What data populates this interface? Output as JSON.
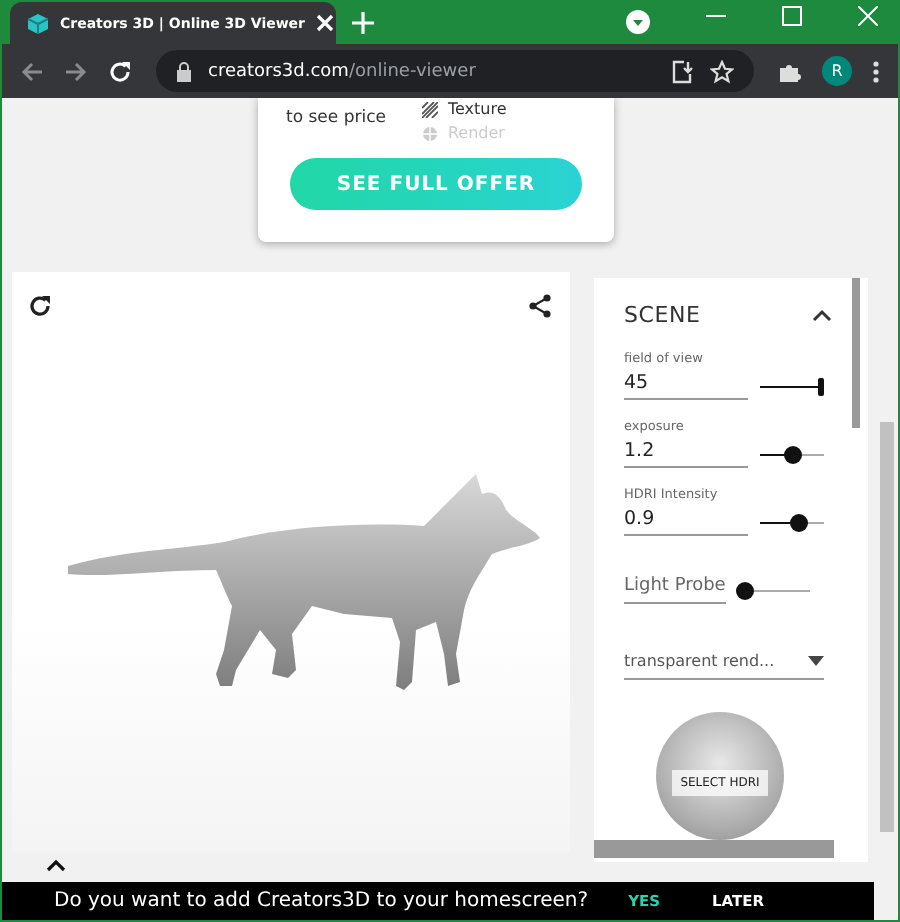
{
  "browser": {
    "tab_title": "Creators 3D | Online 3D Viewer",
    "address": {
      "domain": "creators3d.com",
      "path": "/online-viewer"
    },
    "profile_initial": "R"
  },
  "offer_card": {
    "price_note": "to see price",
    "features": [
      {
        "label": "Texture",
        "disabled": false
      },
      {
        "label": "Render",
        "disabled": true
      }
    ],
    "button": "SEE FULL OFFER"
  },
  "scene_panel": {
    "title": "SCENE",
    "expanded": true,
    "controls": [
      {
        "kind": "slider",
        "label": "field of view",
        "value": "45",
        "level": 1.0
      },
      {
        "kind": "slider",
        "label": "exposure",
        "value": "1.2",
        "level": 0.5
      },
      {
        "kind": "slider",
        "label": "HDRI Intensity",
        "value": "0.9",
        "level": 0.62
      },
      {
        "kind": "toggle",
        "label": "Light Probe",
        "on": false
      },
      {
        "kind": "select",
        "value": "transparent rend..."
      }
    ],
    "hdri_button": "SELECT HDRI"
  },
  "banner": {
    "message": "Do you want to add Creators3D to your homescreen?",
    "actions": [
      "YES",
      "LATER"
    ]
  }
}
